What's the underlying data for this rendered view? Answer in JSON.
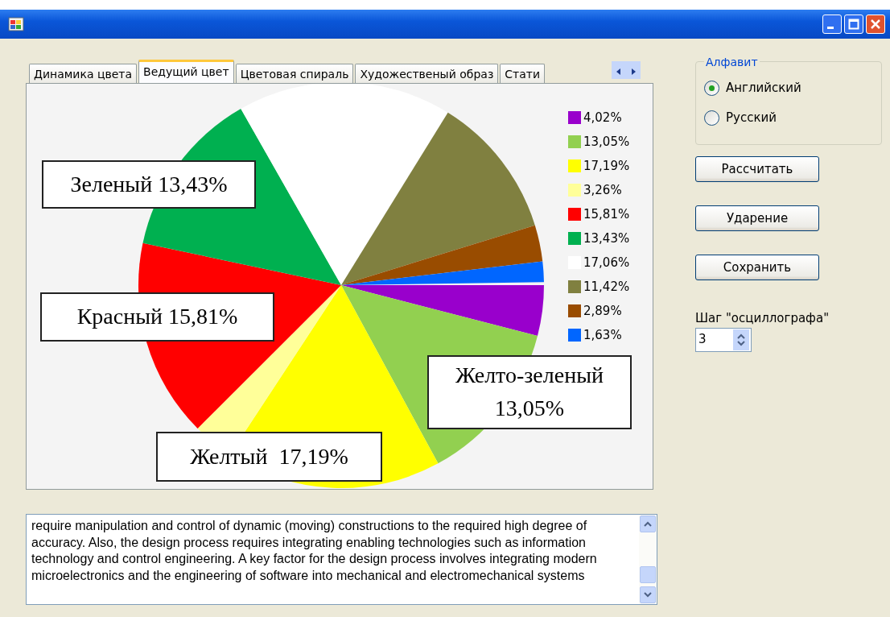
{
  "tabs": [
    {
      "label": "Динамика цвета",
      "selected": false
    },
    {
      "label": "Ведущий цвет",
      "selected": true
    },
    {
      "label": "Цветовая спираль",
      "selected": false
    },
    {
      "label": "Художественый образ",
      "selected": false
    },
    {
      "label": "Стати",
      "selected": false
    }
  ],
  "chart": {
    "chart_data": {
      "type": "pie",
      "categories": [
        "4,02%",
        "13,05%",
        "17,19%",
        "3,26%",
        "15,81%",
        "13,43%",
        "17,06%",
        "11,42%",
        "2,89%",
        "1,63%"
      ],
      "values": [
        4.02,
        13.05,
        17.19,
        3.26,
        15.81,
        13.43,
        17.06,
        11.42,
        2.89,
        1.63
      ],
      "colors": [
        "#9900cc",
        "#92d050",
        "#ffff00",
        "#ffff99",
        "#ff0000",
        "#00b050",
        "#ffffff",
        "#808040",
        "#994c00",
        "#0066ff"
      ],
      "legend": true,
      "annotations": [
        {
          "text": "Зеленый 13,43%"
        },
        {
          "text": "Красный 15,81%"
        },
        {
          "text": "Желтый  17,19%"
        },
        {
          "text": "Желто-зеленый 13,05%"
        }
      ]
    }
  },
  "alphabet": {
    "title": "Алфавит",
    "options": [
      {
        "label": "Английский",
        "selected": true
      },
      {
        "label": "Русский",
        "selected": false
      }
    ]
  },
  "buttons": [
    "Рассчитать",
    "Ударение",
    "Сохранить"
  ],
  "step": {
    "label": "Шаг \"осциллографа\"",
    "value": "3"
  },
  "text_box": {
    "value": "require manipulation and control of dynamic (moving) constructions to the required high degree of accuracy. Also, the design process requires integrating enabling technologies such as information technology and control engineering. A key factor for the design process involves integrating modern microelectronics and the engineering of software into mechanical and electromechanical systems"
  }
}
